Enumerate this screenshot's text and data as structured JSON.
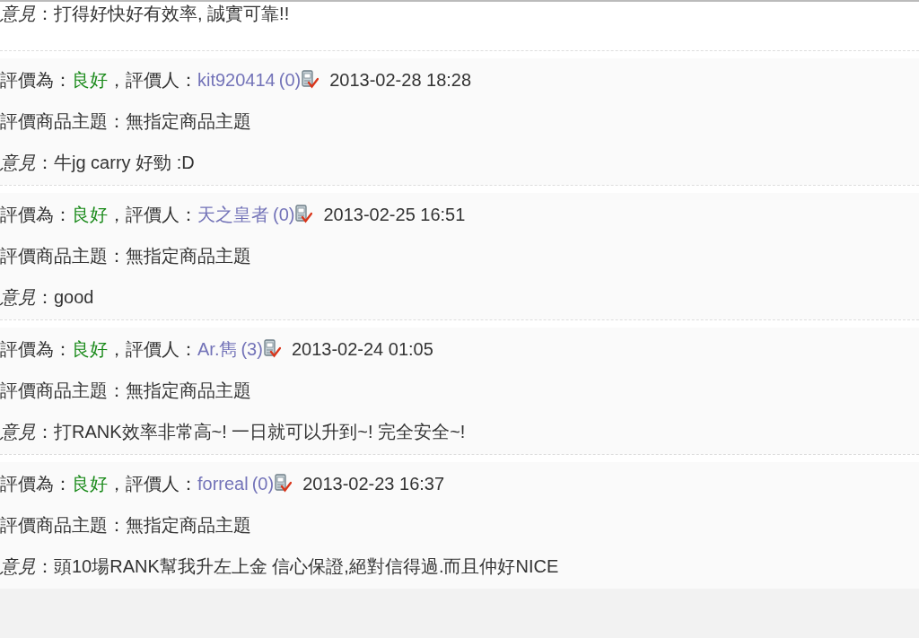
{
  "partial_entry": {
    "comment": "*意見*：打得好快好有效率, 誠實可靠!!"
  },
  "ratings": [
    {
      "rating_label": "評價為：",
      "rating": "良好",
      "rater_label": "，評價人：",
      "rater": "kit920414",
      "count": "(0)",
      "date": "2013-02-28 18:28",
      "subject": "評價商品主題：無指定商品主題",
      "comment": "*意見*：牛jg carry 好勁 :D"
    },
    {
      "rating_label": "評價為：",
      "rating": "良好",
      "rater_label": "，評價人：",
      "rater": "天之皇者",
      "count": "(0)",
      "date": "2013-02-25 16:51",
      "subject": "評價商品主題：無指定商品主題",
      "comment": "*意見*：good"
    },
    {
      "rating_label": "評價為：",
      "rating": "良好",
      "rater_label": "，評價人：",
      "rater": "Ar.雋",
      "count": "(3)",
      "date": "2013-02-24 01:05",
      "subject": "評價商品主題：無指定商品主題",
      "comment": "*意見*：打RANK效率非常高~! 一日就可以升到~! 完全安全~!"
    },
    {
      "rating_label": "評價為：",
      "rating": "良好",
      "rater_label": "，評價人：",
      "rater": "forreal",
      "count": "(0)",
      "date": "2013-02-23 16:37",
      "subject": "評價商品主題：無指定商品主題",
      "comment": "*意見*：頭10場RANK幫我升左上金 信心保證,絕對信得過.而且仲好NICE"
    }
  ]
}
